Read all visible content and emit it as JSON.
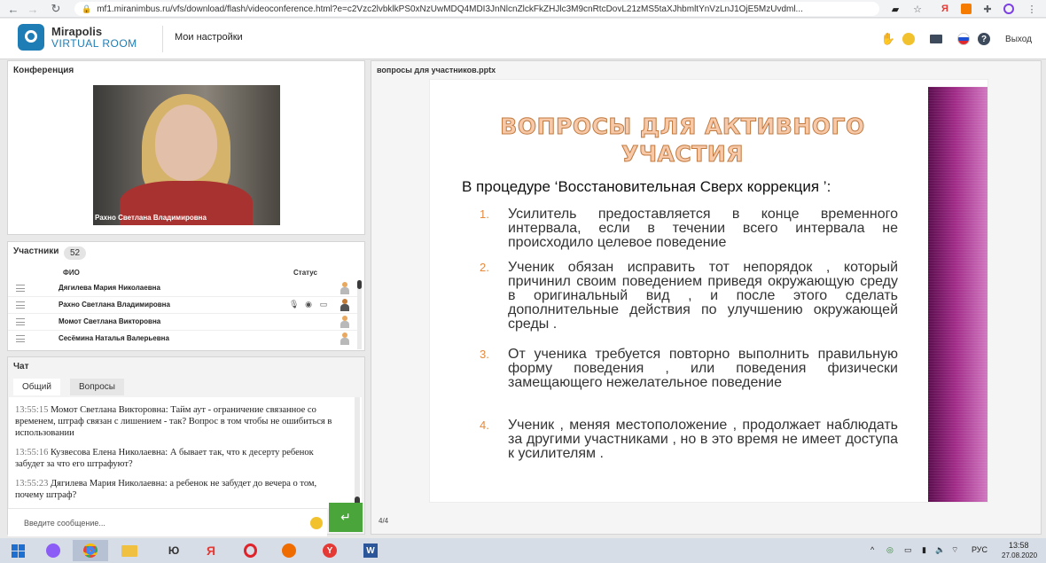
{
  "browser": {
    "url": "mf1.miranimbus.ru/vfs/download/flash/videoconference.html?e=c2Vzc2lvbklkPS0xNzUwMDQ4MDI3JnNlcnZlckFkZHJlc3M9cnRtcDovL21zMS5taXJhbmltYnVzLnJ1OjE5MzUvdml..."
  },
  "header": {
    "logo_line1": "Mirapolis",
    "logo_line2": "VIRTUAL ROOM",
    "settings_label": "Мои настройки",
    "exit_label": "Выход"
  },
  "conference": {
    "title": "Конференция",
    "video_name": "Рахно Светлана Владимировна"
  },
  "participants": {
    "title": "Участники",
    "count": "52",
    "col_name": "ФИО",
    "col_status": "Статус",
    "rows": [
      {
        "name": "Дягилева Мария Николаевна"
      },
      {
        "name": "Рахно Светлана Владимировна"
      },
      {
        "name": "Момот Светлана   Викторовна"
      },
      {
        "name": "Сесёмина Наталья  Валерьевна"
      }
    ]
  },
  "chat": {
    "title": "Чат",
    "tabs": [
      "Общий",
      "Вопросы"
    ],
    "messages": [
      {
        "time": "13:55:15",
        "text": "Момот Светлана   Викторовна: Тайм аут - ограничение связанное со временем, штраф связан с лишением - так? Вопрос в том чтобы не ошибиться в использовании"
      },
      {
        "time": "13:55:16",
        "text": "Кузвесова Елена  Николаевна: А бывает так, что к десерту ребенок забудет за что его штрафуют?"
      },
      {
        "time": "13:55:23",
        "text": "Дягилева Мария Николаевна: а ребенок не забудет до вечера о том, почему штраф?"
      }
    ],
    "placeholder": "Введите сообщение..."
  },
  "presentation": {
    "file": "вопросы для участников.pptx",
    "slide": {
      "title_line1": "ВОПРОСЫ ДЛЯ АКТИВНОГО",
      "title_line2": "УЧАСТИЯ",
      "subtitle": "В процедуре ‘Восстановительная Сверх коррекция ’:",
      "items": [
        {
          "num": "1.",
          "text": "Усилитель предоставляется в конце временного интервала, если в течении всего интервала не происходило целевое поведение"
        },
        {
          "num": "2.",
          "text": "Ученик обязан исправить тот непорядок , который причинил своим поведением приведя окружающую среду в оригинальный вид , и после этого сделать дополнительные действия по улучшению окружающей среды ."
        },
        {
          "num": "3.",
          "text": "От ученика требуется повторно выполнить правильную форму поведения , или поведения физически замещающего нежелательное поведение"
        },
        {
          "num": "4.",
          "text": "Ученик , меняя местоположение , продолжает наблюдать за другими участниками , но в это время не имеет доступа к усилителям ."
        }
      ]
    },
    "page_indicator": "4/4"
  },
  "taskbar": {
    "lang": "РУС",
    "time": "13:58",
    "date": "27.08.2020"
  },
  "colors": {
    "accent_green": "#4aa63a",
    "brand_blue": "#1f7db5",
    "slide_purple": "#a12c88",
    "list_number_orange": "#e48a3e"
  }
}
